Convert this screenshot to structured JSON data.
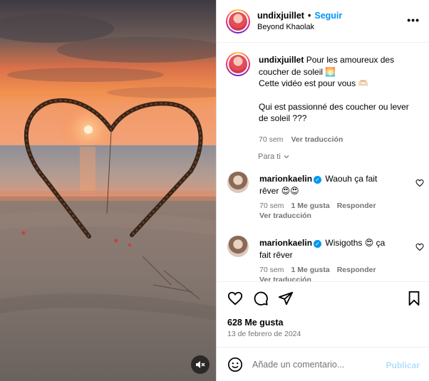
{
  "header": {
    "username": "undixjuillet",
    "separator": "•",
    "follow_label": "Seguir",
    "location": "Beyond Khaolak",
    "more_icon": "more-horizontal-icon"
  },
  "caption": {
    "username": "undixjuillet",
    "line1": "Pour les amoureux des coucher de soleil 🌅",
    "line2": "Cette vidéo est pour vous 🫶🏻",
    "line3": "Qui est passionné des coucher ou lever de soleil ???",
    "time": "70 sem",
    "translate_label": "Ver traducción"
  },
  "for_you": {
    "label": "Para ti"
  },
  "comments": [
    {
      "username": "marionkaelin",
      "text": "Waouh ça fait rêver 😍😍",
      "time": "70 sem",
      "reply_label": "Responder",
      "translate_label": "Ver traducción"
    },
    {
      "username": "marionkaelin",
      "text": "Wisigoths 😍 ça fait rêver",
      "time": "70 sem",
      "likes": "1 Me gusta",
      "reply_label": "Responder",
      "translate_label": "Ver traducción"
    }
  ],
  "comment0_likes": "1 Me gusta",
  "post": {
    "likes": "628 Me gusta",
    "date": "13 de febrero de 2024"
  },
  "composer": {
    "placeholder": "Añade un comentario...",
    "post_label": "Publicar"
  },
  "colors": {
    "accent": "#0095f6",
    "muted": "#737373",
    "post_disabled": "#b2dffc"
  }
}
